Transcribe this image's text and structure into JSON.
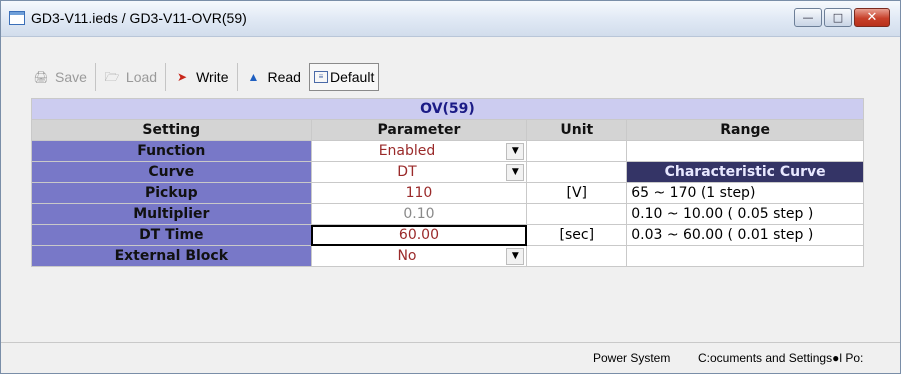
{
  "window": {
    "title": "GD3-V11.ieds / GD3-V11-OVR(59)"
  },
  "toolbar": {
    "save": "Save",
    "load": "Load",
    "write": "Write",
    "read": "Read",
    "default": "Default"
  },
  "table": {
    "caption": "OV(59)",
    "headers": {
      "setting": "Setting",
      "parameter": "Parameter",
      "unit": "Unit",
      "range": "Range"
    },
    "rows": [
      {
        "setting": "Function",
        "parameter": "Enabled",
        "unit": "",
        "range": ""
      },
      {
        "setting": "Curve",
        "parameter": "DT",
        "unit": "",
        "range": "Characteristic Curve"
      },
      {
        "setting": "Pickup",
        "parameter": "110",
        "unit": "[V]",
        "range": "65 ~ 170 (1 step)"
      },
      {
        "setting": "Multiplier",
        "parameter": "0.10",
        "unit": "",
        "range": "0.10 ~ 10.00 ( 0.05 step )"
      },
      {
        "setting": "DT Time",
        "parameter": "60.00",
        "unit": "[sec]",
        "range": "0.03 ~ 60.00 ( 0.01 step )"
      },
      {
        "setting": "External Block",
        "parameter": "No",
        "unit": "",
        "range": ""
      }
    ]
  },
  "statusbar": {
    "section": "Power System",
    "path": "C:ocuments and Settings●l Po:"
  },
  "colors": {
    "label_bg": "#7878c8",
    "caption_bg": "#ccccf0",
    "char_curve_bg": "#343466",
    "value_text": "#9a2a2a"
  }
}
